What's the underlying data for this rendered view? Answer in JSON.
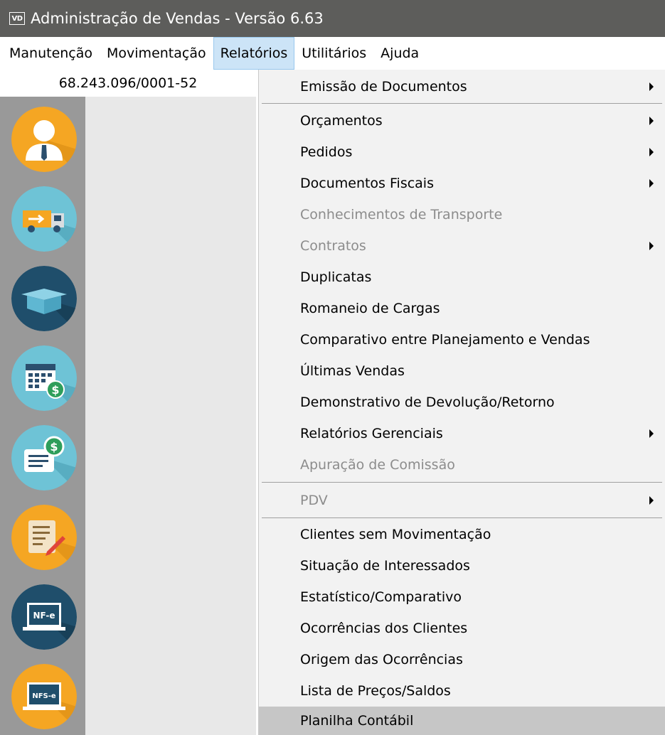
{
  "window": {
    "badge": "VD",
    "title": "Administração de Vendas - Versão 6.63"
  },
  "menubar": {
    "items": [
      "Manutenção",
      "Movimentação",
      "Relatórios",
      "Utilitários",
      "Ajuda"
    ],
    "active": "Relatórios"
  },
  "company": {
    "cnpj": "68.243.096/0001-52"
  },
  "sidebar": {
    "buttons": [
      {
        "icon": "person-icon",
        "color": "#f5a623"
      },
      {
        "icon": "delivery-truck-icon",
        "color": "#6ec3d6"
      },
      {
        "icon": "box-icon",
        "color": "#1f4e6b"
      },
      {
        "icon": "calendar-money-icon",
        "color": "#6ec3d6"
      },
      {
        "icon": "document-money-icon",
        "color": "#6ec3d6"
      },
      {
        "icon": "checklist-pen-icon",
        "color": "#f5a623"
      },
      {
        "icon": "nfe-laptop-icon",
        "color": "#1f4e6b",
        "label": "NF-e"
      },
      {
        "icon": "nfse-laptop-icon",
        "color": "#f5a623",
        "label": "NFS-e"
      }
    ]
  },
  "dropdown": {
    "items": [
      {
        "label": "Emissão de Documentos",
        "submenu": true,
        "disabled": false
      },
      {
        "label": "Orçamentos",
        "submenu": true,
        "disabled": false
      },
      {
        "label": "Pedidos",
        "submenu": true,
        "disabled": false
      },
      {
        "label": "Documentos Fiscais",
        "submenu": true,
        "disabled": false
      },
      {
        "label": "Conhecimentos de Transporte",
        "submenu": false,
        "disabled": true
      },
      {
        "label": "Contratos",
        "submenu": true,
        "disabled": true
      },
      {
        "label": "Duplicatas",
        "submenu": false,
        "disabled": false
      },
      {
        "label": "Romaneio de Cargas",
        "submenu": false,
        "disabled": false
      },
      {
        "label": "Comparativo entre Planejamento e Vendas",
        "submenu": false,
        "disabled": false
      },
      {
        "label": "Últimas Vendas",
        "submenu": false,
        "disabled": false
      },
      {
        "label": "Demonstrativo de Devolução/Retorno",
        "submenu": false,
        "disabled": false
      },
      {
        "label": "Relatórios Gerenciais",
        "submenu": true,
        "disabled": false
      },
      {
        "label": "Apuração de Comissão",
        "submenu": false,
        "disabled": true
      },
      {
        "label": "PDV",
        "submenu": true,
        "disabled": true
      },
      {
        "label": "Clientes sem Movimentação",
        "submenu": false,
        "disabled": false
      },
      {
        "label": "Situação de Interessados",
        "submenu": false,
        "disabled": false
      },
      {
        "label": "Estatístico/Comparativo",
        "submenu": false,
        "disabled": false
      },
      {
        "label": "Ocorrências dos Clientes",
        "submenu": false,
        "disabled": false
      },
      {
        "label": "Origem das Ocorrências",
        "submenu": false,
        "disabled": false
      },
      {
        "label": "Lista de Preços/Saldos",
        "submenu": false,
        "disabled": false
      },
      {
        "label": "Planilha Contábil",
        "submenu": false,
        "disabled": false,
        "highlighted": true
      }
    ]
  }
}
